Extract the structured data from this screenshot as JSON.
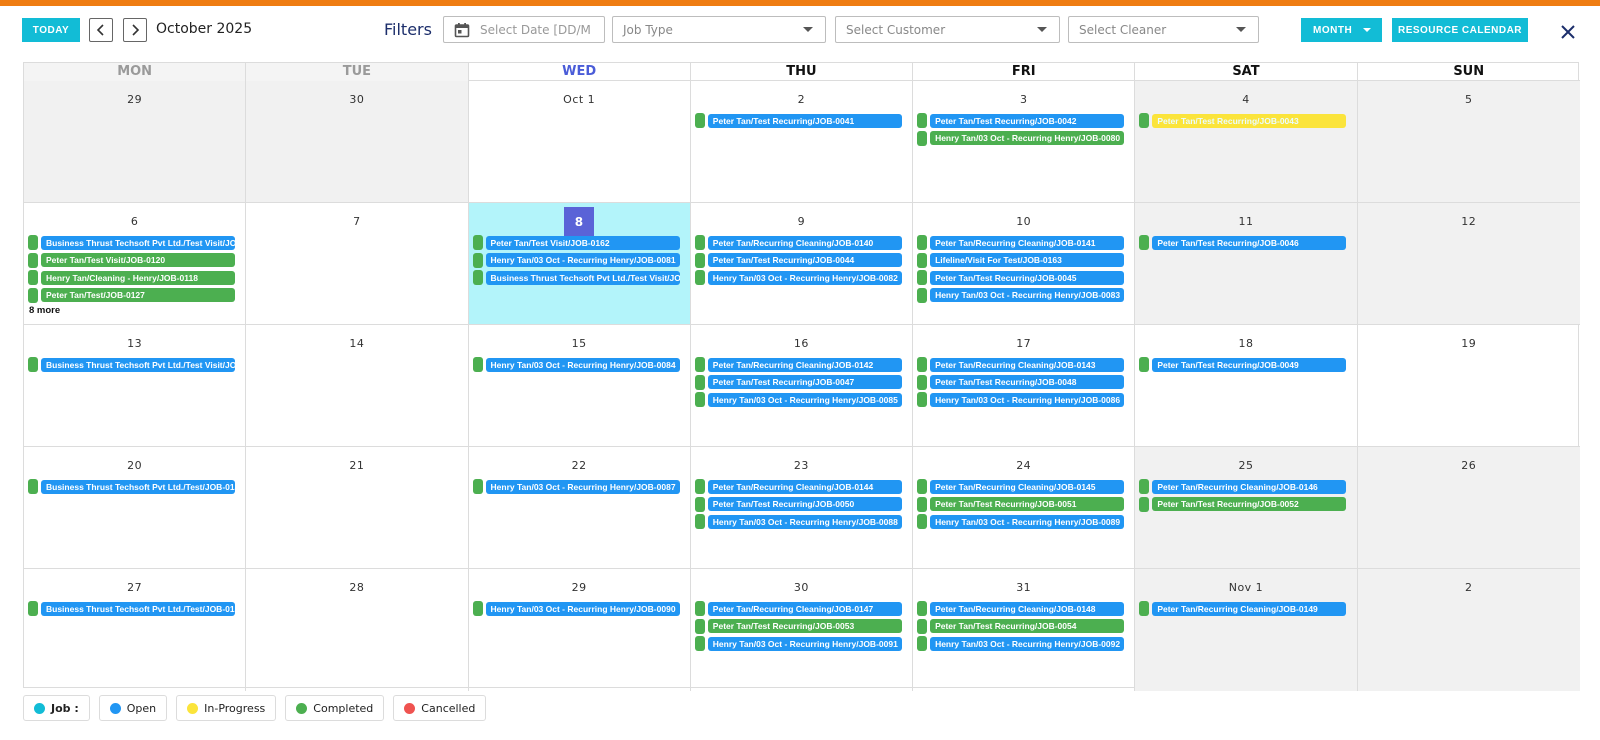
{
  "toolbar": {
    "today_label": "TODAY",
    "month_label": "October 2025",
    "filters_label": "Filters",
    "date_placeholder": "Select Date [DD/MM/YYYY]",
    "job_type_placeholder": "Job Type",
    "customer_placeholder": "Select Customer",
    "cleaner_placeholder": "Select Cleaner",
    "view_label": "MONTH",
    "resource_label": "RESOURCE CALENDAR"
  },
  "colors": {
    "accent": "#12bcd6",
    "top_stripe": "#ef7d12",
    "open": "#2196f3",
    "in_progress": "#fbe43b",
    "completed": "#4caf50",
    "cancelled": "#ef5350",
    "today_cell": "#b3f4fa"
  },
  "weekdays": [
    "MON",
    "TUE",
    "WED",
    "THU",
    "FRI",
    "SAT",
    "SUN"
  ],
  "weeks": [
    [
      {
        "label": "29",
        "gray": true,
        "events": []
      },
      {
        "label": "30",
        "gray": true,
        "events": []
      },
      {
        "label": "Oct 1",
        "events": []
      },
      {
        "label": "2",
        "events": [
          {
            "text": "Peter Tan/Test Recurring/JOB-0041",
            "status": "open"
          }
        ]
      },
      {
        "label": "3",
        "events": [
          {
            "text": "Peter Tan/Test Recurring/JOB-0042",
            "status": "open"
          },
          {
            "text": "Henry Tan/03 Oct - Recurring Henry/JOB-0080",
            "status": "done"
          }
        ]
      },
      {
        "label": "4",
        "gray": true,
        "events": [
          {
            "text": "Peter Tan/Test Recurring/JOB-0043",
            "status": "inprog"
          }
        ]
      },
      {
        "label": "5",
        "gray": true,
        "events": []
      }
    ],
    [
      {
        "label": "6",
        "events": [
          {
            "text": "Business Thrust Techsoft Pvt Ltd./Test Visit/JOB-0",
            "status": "open"
          },
          {
            "text": "Peter Tan/Test Visit/JOB-0120",
            "status": "done"
          },
          {
            "text": "Henry Tan/Cleaning - Henry/JOB-0118",
            "status": "done"
          },
          {
            "text": "Peter Tan/Test/JOB-0127",
            "status": "done"
          }
        ],
        "more": "8 more"
      },
      {
        "label": "7",
        "events": []
      },
      {
        "label": "8",
        "today": true,
        "events": [
          {
            "text": "Peter Tan/Test Visit/JOB-0162",
            "status": "open"
          },
          {
            "text": "Henry Tan/03 Oct - Recurring Henry/JOB-0081",
            "status": "open"
          },
          {
            "text": "Business Thrust Techsoft Pvt Ltd./Test Visit/JOB-0",
            "status": "open"
          }
        ]
      },
      {
        "label": "9",
        "events": [
          {
            "text": "Peter Tan/Recurring Cleaning/JOB-0140",
            "status": "open"
          },
          {
            "text": "Peter Tan/Test Recurring/JOB-0044",
            "status": "open"
          },
          {
            "text": "Henry Tan/03 Oct - Recurring Henry/JOB-0082",
            "status": "open"
          }
        ]
      },
      {
        "label": "10",
        "events": [
          {
            "text": "Peter Tan/Recurring Cleaning/JOB-0141",
            "status": "open"
          },
          {
            "text": "Lifeline/Visit For Test/JOB-0163",
            "status": "open"
          },
          {
            "text": "Peter Tan/Test Recurring/JOB-0045",
            "status": "open"
          },
          {
            "text": "Henry Tan/03 Oct - Recurring Henry/JOB-0083",
            "status": "open"
          }
        ]
      },
      {
        "label": "11",
        "gray": true,
        "events": [
          {
            "text": "Peter Tan/Test Recurring/JOB-0046",
            "status": "open"
          }
        ]
      },
      {
        "label": "12",
        "gray": true,
        "events": []
      }
    ],
    [
      {
        "label": "13",
        "events": [
          {
            "text": "Business Thrust Techsoft Pvt Ltd./Test Visit/JOB-0",
            "status": "open"
          }
        ]
      },
      {
        "label": "14",
        "events": []
      },
      {
        "label": "15",
        "events": [
          {
            "text": "Henry Tan/03 Oct - Recurring Henry/JOB-0084",
            "status": "open"
          }
        ]
      },
      {
        "label": "16",
        "events": [
          {
            "text": "Peter Tan/Recurring Cleaning/JOB-0142",
            "status": "open"
          },
          {
            "text": "Peter Tan/Test Recurring/JOB-0047",
            "status": "open"
          },
          {
            "text": "Henry Tan/03 Oct - Recurring Henry/JOB-0085",
            "status": "open"
          }
        ]
      },
      {
        "label": "17",
        "events": [
          {
            "text": "Peter Tan/Recurring Cleaning/JOB-0143",
            "status": "open"
          },
          {
            "text": "Peter Tan/Test Recurring/JOB-0048",
            "status": "open"
          },
          {
            "text": "Henry Tan/03 Oct - Recurring Henry/JOB-0086",
            "status": "open"
          }
        ]
      },
      {
        "label": "18",
        "events": [
          {
            "text": "Peter Tan/Test Recurring/JOB-0049",
            "status": "open"
          }
        ]
      },
      {
        "label": "19",
        "events": []
      }
    ],
    [
      {
        "label": "20",
        "events": [
          {
            "text": "Business Thrust Techsoft Pvt Ltd./Test/JOB-0132",
            "status": "open"
          }
        ]
      },
      {
        "label": "21",
        "events": []
      },
      {
        "label": "22",
        "events": [
          {
            "text": "Henry Tan/03 Oct - Recurring Henry/JOB-0087",
            "status": "open"
          }
        ]
      },
      {
        "label": "23",
        "events": [
          {
            "text": "Peter Tan/Recurring Cleaning/JOB-0144",
            "status": "open"
          },
          {
            "text": "Peter Tan/Test Recurring/JOB-0050",
            "status": "open"
          },
          {
            "text": "Henry Tan/03 Oct - Recurring Henry/JOB-0088",
            "status": "open"
          }
        ]
      },
      {
        "label": "24",
        "events": [
          {
            "text": "Peter Tan/Recurring Cleaning/JOB-0145",
            "status": "open"
          },
          {
            "text": "Peter Tan/Test Recurring/JOB-0051",
            "status": "done"
          },
          {
            "text": "Henry Tan/03 Oct - Recurring Henry/JOB-0089",
            "status": "open"
          }
        ]
      },
      {
        "label": "25",
        "gray": true,
        "events": [
          {
            "text": "Peter Tan/Recurring Cleaning/JOB-0146",
            "status": "open"
          },
          {
            "text": "Peter Tan/Test Recurring/JOB-0052",
            "status": "done"
          }
        ]
      },
      {
        "label": "26",
        "gray": true,
        "events": []
      }
    ],
    [
      {
        "label": "27",
        "events": [
          {
            "text": "Business Thrust Techsoft Pvt Ltd./Test/JOB-0133",
            "status": "open"
          }
        ]
      },
      {
        "label": "28",
        "events": []
      },
      {
        "label": "29",
        "events": [
          {
            "text": "Henry Tan/03 Oct - Recurring Henry/JOB-0090",
            "status": "open"
          }
        ]
      },
      {
        "label": "30",
        "events": [
          {
            "text": "Peter Tan/Recurring Cleaning/JOB-0147",
            "status": "open"
          },
          {
            "text": "Peter Tan/Test Recurring/JOB-0053",
            "status": "done"
          },
          {
            "text": "Henry Tan/03 Oct - Recurring Henry/JOB-0091",
            "status": "open"
          }
        ]
      },
      {
        "label": "31",
        "events": [
          {
            "text": "Peter Tan/Recurring Cleaning/JOB-0148",
            "status": "open"
          },
          {
            "text": "Peter Tan/Test Recurring/JOB-0054",
            "status": "done"
          },
          {
            "text": "Henry Tan/03 Oct - Recurring Henry/JOB-0092",
            "status": "open"
          }
        ]
      },
      {
        "label": "Nov 1",
        "gray": true,
        "events": [
          {
            "text": "Peter Tan/Recurring Cleaning/JOB-0149",
            "status": "open"
          }
        ]
      },
      {
        "label": "2",
        "gray": true,
        "events": []
      }
    ]
  ],
  "legend": {
    "job_label": "Job :",
    "items": [
      {
        "label": "Open",
        "color": "#2196f3"
      },
      {
        "label": "In-Progress",
        "color": "#fbe43b"
      },
      {
        "label": "Completed",
        "color": "#4caf50"
      },
      {
        "label": "Cancelled",
        "color": "#ef5350"
      }
    ]
  }
}
